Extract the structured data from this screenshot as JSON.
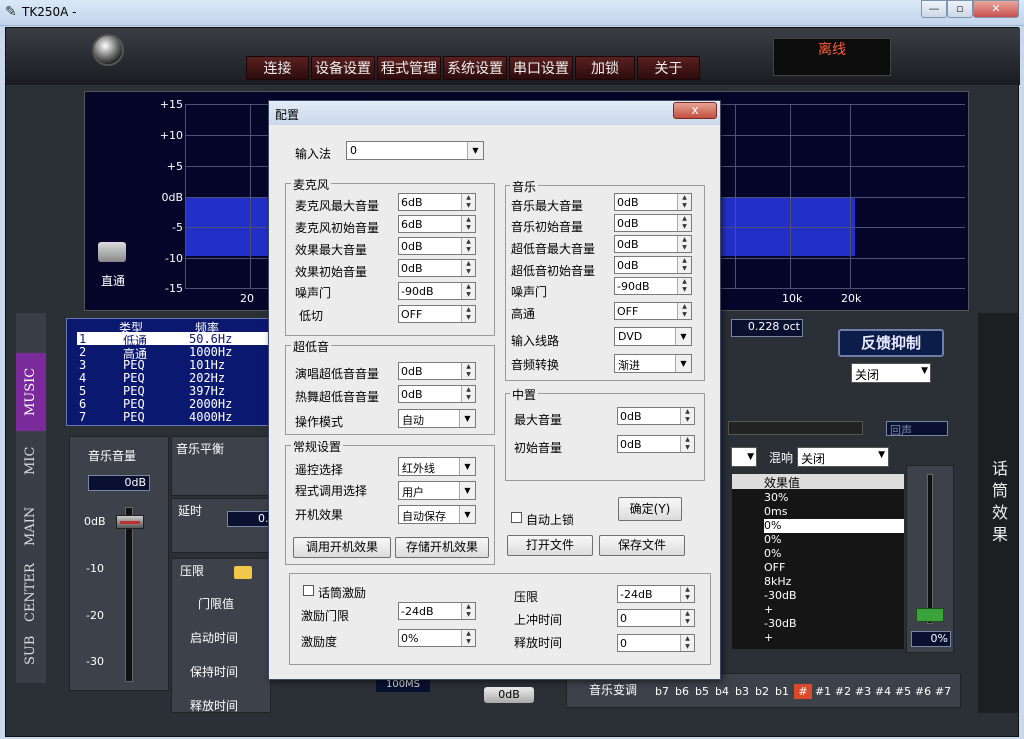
{
  "window": {
    "title": "TK250A -",
    "min": "—",
    "max": "▫",
    "close": "✕"
  },
  "menu": [
    "连接",
    "设备设置",
    "程式管理",
    "系统设置",
    "串口设置",
    "加锁",
    "关于"
  ],
  "status": "离线",
  "graph": {
    "y_ticks": [
      "+15",
      "+10",
      "+5",
      "0dB",
      "-5",
      "-10",
      "-15"
    ],
    "x_ticks": [
      "20",
      "10k",
      "20k"
    ],
    "bypass": "直通"
  },
  "tabs": [
    "MUSIC",
    "MIC",
    "MAIN",
    "CENTER",
    "SUB"
  ],
  "peq": {
    "headers": [
      "类型",
      "频率"
    ],
    "rows": [
      {
        "n": "1",
        "type": "低通",
        "freq": "50.6Hz"
      },
      {
        "n": "2",
        "type": "高通",
        "freq": "1000Hz"
      },
      {
        "n": "3",
        "type": "PEQ",
        "freq": "101Hz"
      },
      {
        "n": "4",
        "type": "PEQ",
        "freq": "202Hz"
      },
      {
        "n": "5",
        "type": "PEQ",
        "freq": "397Hz"
      },
      {
        "n": "6",
        "type": "PEQ",
        "freq": "2000Hz"
      },
      {
        "n": "7",
        "type": "PEQ",
        "freq": "4000Hz"
      }
    ]
  },
  "left_panels": {
    "music_volume": "音乐音量",
    "music_volume_value": "0dB",
    "scale": [
      "0dB",
      "-10",
      "-20",
      "-30"
    ],
    "balance": "音乐平衡",
    "delay": "延时",
    "delay_value": "0.",
    "limiter": "压限",
    "limiter_rows": [
      "门限值",
      "启动时间",
      "保持时间",
      "释放时间"
    ],
    "release_value": "100MS",
    "gain_value": "0dB"
  },
  "right": {
    "octave": "0.228 oct",
    "feedback": "反馈抑制",
    "feedback_value": "关闭",
    "reverb_label": "混响",
    "reverb_value": "关闭",
    "echo": "回声",
    "effects_header": "效果值",
    "effects": [
      "30%",
      "0ms",
      "0%",
      "0%",
      "0%",
      "OFF",
      "8kHz",
      "-30dB",
      "+",
      "-30dB",
      "+"
    ],
    "vert_label": "话筒效果",
    "mic_percent": "0%",
    "music_key": "音乐变调",
    "keys": [
      "b7",
      "b6",
      "b5",
      "b4",
      "b3",
      "b2",
      "b1",
      "#",
      "#1",
      "#2",
      "#3",
      "#4",
      "#5",
      "#6",
      "#7"
    ]
  },
  "dialog": {
    "title": "配置",
    "close": "x",
    "input_method_label": "输入法",
    "input_method_value": "0",
    "mic": {
      "title": "麦克风",
      "rows": [
        {
          "label": "麦克风最大音量",
          "value": "6dB"
        },
        {
          "label": "麦克风初始音量",
          "value": "6dB"
        },
        {
          "label": "效果最大音量",
          "value": "0dB"
        },
        {
          "label": "效果初始音量",
          "value": "0dB"
        },
        {
          "label": "噪声门",
          "value": "-90dB"
        },
        {
          "label": "低切",
          "value": "OFF"
        }
      ]
    },
    "music": {
      "title": "音乐",
      "rows": [
        {
          "label": "音乐最大音量",
          "value": "0dB"
        },
        {
          "label": "音乐初始音量",
          "value": "0dB"
        },
        {
          "label": "超低音最大音量",
          "value": "0dB"
        },
        {
          "label": "超低音初始音量",
          "value": "0dB"
        },
        {
          "label": "噪声门",
          "value": "-90dB"
        },
        {
          "label": "高通",
          "value": "OFF"
        }
      ],
      "input_route_label": "输入线路",
      "input_route_value": "DVD",
      "switch_label": "音频转换",
      "switch_value": "渐进"
    },
    "sub": {
      "title": "超低音",
      "rows": [
        {
          "label": "演唱超低音音量",
          "value": "0dB"
        },
        {
          "label": "热舞超低音音量",
          "value": "0dB"
        }
      ],
      "mode_label": "操作模式",
      "mode_value": "自动"
    },
    "center": {
      "title": "中置",
      "rows": [
        {
          "label": "最大音量",
          "value": "0dB"
        },
        {
          "label": "初始音量",
          "value": "0dB"
        }
      ]
    },
    "general": {
      "title": "常规设置",
      "rows": [
        {
          "label": "遥控选择",
          "value": "红外线"
        },
        {
          "label": "程式调用选择",
          "value": "用户"
        },
        {
          "label": "开机效果",
          "value": "自动保存"
        }
      ],
      "load_btn": "调用开机效果",
      "save_btn": "存储开机效果"
    },
    "auto_lock": "自动上锁",
    "ok": "确定(Y)",
    "open_file": "打开文件",
    "save_file": "保存文件",
    "exciter": {
      "enable": "话筒激励",
      "threshold_label": "激励门限",
      "threshold_value": "-24dB",
      "degree_label": "激励度",
      "degree_value": "0%"
    },
    "limit": {
      "rows": [
        {
          "label": "压限",
          "value": "-24dB"
        },
        {
          "label": "上冲时间",
          "value": "0"
        },
        {
          "label": "释放时间",
          "value": "0"
        }
      ]
    }
  }
}
